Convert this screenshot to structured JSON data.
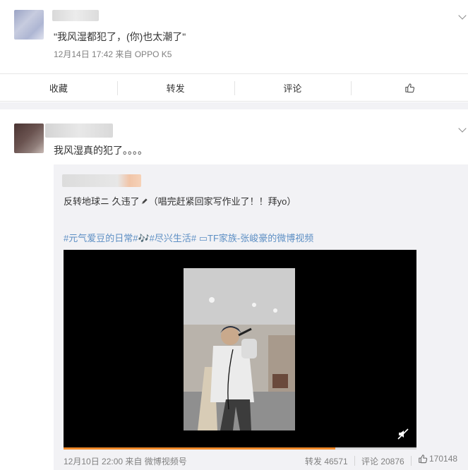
{
  "post1": {
    "text": "\"我风湿都犯了，(你)也太潮了\"",
    "meta": "12月14日 17:42  来自 OPPO K5",
    "actions": {
      "favorite": "收藏",
      "repost": "转发",
      "comment": "评论"
    }
  },
  "post2": {
    "text": "我风湿真的犯了。。。。",
    "repost": {
      "text_a": "反转地球ニ 久违了",
      "text_b": "（唱完赶紧回家写作业了！！拜yo）",
      "tags": "#元气爱豆的日常#🎶#尽兴生活# ▭TF家族-张峻豪的微博视频",
      "video_progress": 0.77,
      "meta": "12月10日 22:00 来自 微博视频号",
      "repost_count": "转发 46571",
      "comment_count": "评论 20876",
      "like_count": "170148"
    }
  },
  "icons": {
    "like": "thumbs-up-icon",
    "expand": "chevron-down-icon",
    "mute": "speaker-muted-icon",
    "pencil": "pencil-icon"
  },
  "colors": {
    "link": "#5d8fc4",
    "progress": "#f08a2a",
    "meta": "#808080"
  }
}
